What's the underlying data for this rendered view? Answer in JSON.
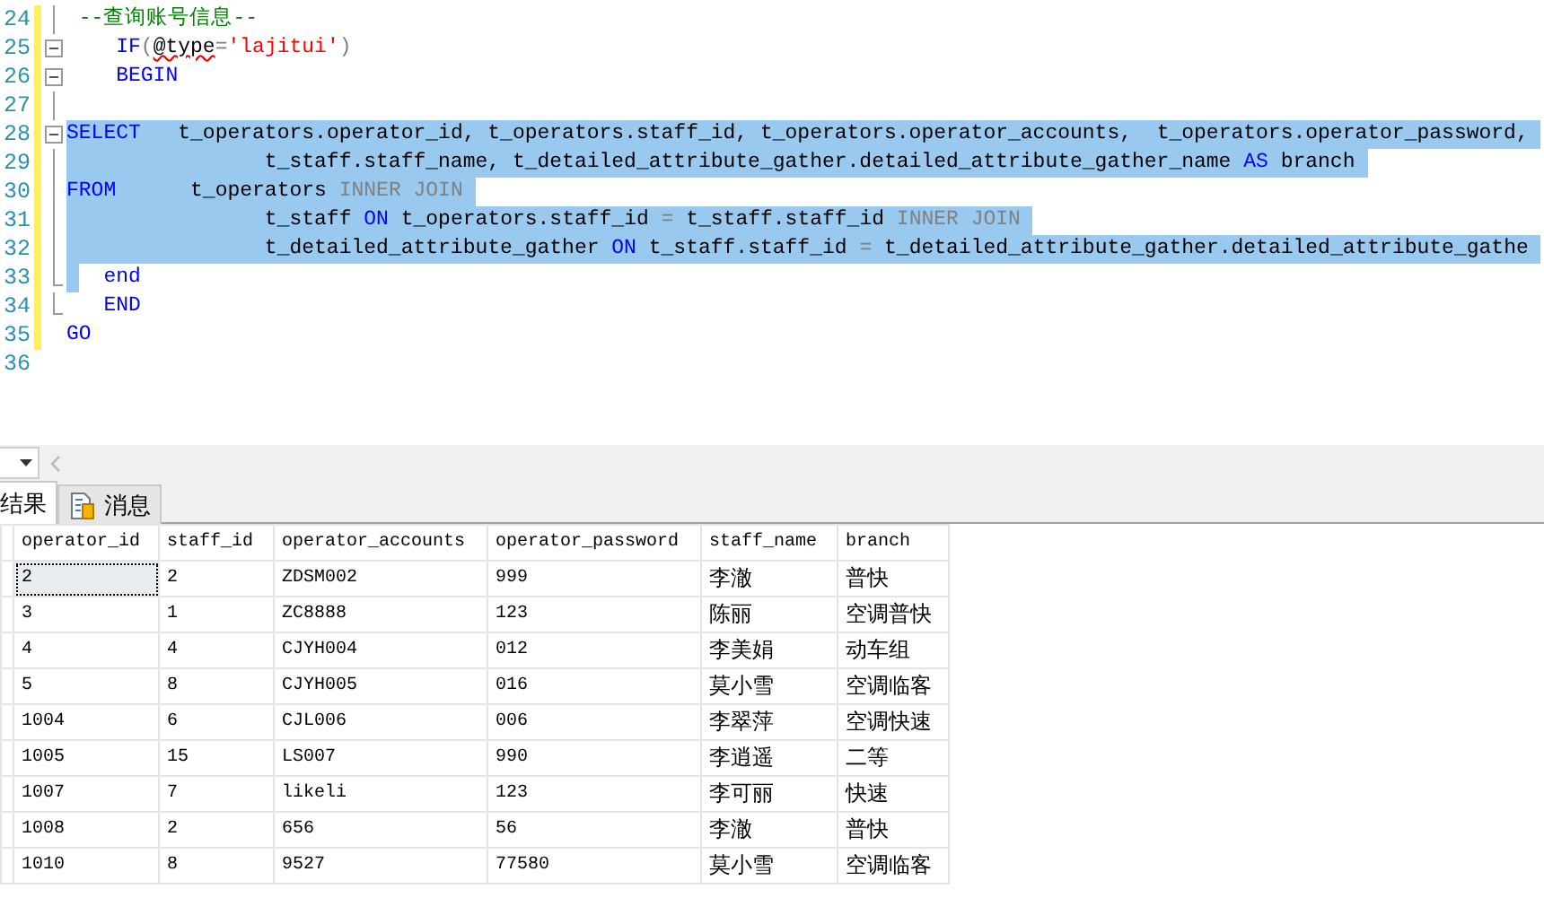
{
  "editor": {
    "lines": [
      {
        "number": "24",
        "modified": true,
        "collapsible": false,
        "outline": true,
        "outline_end": false,
        "kind": "plain",
        "tokens": [
          {
            "text": " --查询账号信息--",
            "kind": "comment"
          }
        ]
      },
      {
        "number": "25",
        "modified": true,
        "collapsible": true,
        "outline": false,
        "outline_end": false,
        "kind": "plain",
        "tokens": [
          {
            "text": "    IF",
            "kind": "keyword"
          },
          {
            "text": "(",
            "kind": "operator"
          },
          {
            "text": "@type",
            "kind": "error"
          },
          {
            "text": "=",
            "kind": "operator"
          },
          {
            "text": "'lajitui'",
            "kind": "string"
          },
          {
            "text": ")",
            "kind": "operator"
          }
        ]
      },
      {
        "number": "26",
        "modified": true,
        "collapsible": true,
        "outline": false,
        "outline_end": false,
        "kind": "plain",
        "tokens": [
          {
            "text": "    BEGIN",
            "kind": "keyword"
          }
        ]
      },
      {
        "number": "27",
        "modified": true,
        "collapsible": false,
        "outline": true,
        "outline_end": false,
        "kind": "plain"
      },
      {
        "number": "28",
        "modified": true,
        "collapsible": true,
        "outline": false,
        "outline_end": false,
        "kind": "selected",
        "tokens": [
          {
            "text": "SELECT",
            "kind": "keyword"
          },
          {
            "text": "   t_operators.operator_id, t_operators.staff_id, t_operators.operator_accounts,  t_operators.operator_password,",
            "kind": "plain"
          }
        ]
      },
      {
        "number": "29",
        "modified": true,
        "collapsible": false,
        "outline": true,
        "outline_end": false,
        "kind": "selected",
        "tokens": [
          {
            "text": "                t_staff.staff_name, t_detailed_attribute_gather.detailed_attribute_gather_name ",
            "kind": "plain"
          },
          {
            "text": "AS",
            "kind": "keyword"
          },
          {
            "text": " branch",
            "kind": "plain"
          }
        ]
      },
      {
        "number": "30",
        "modified": true,
        "collapsible": false,
        "outline": true,
        "outline_end": false,
        "kind": "selected",
        "tokens": [
          {
            "text": "FROM",
            "kind": "keyword"
          },
          {
            "text": "      t_operators ",
            "kind": "plain"
          },
          {
            "text": "INNER JOIN",
            "kind": "operator"
          }
        ]
      },
      {
        "number": "31",
        "modified": true,
        "collapsible": false,
        "outline": true,
        "outline_end": false,
        "kind": "selected",
        "tokens": [
          {
            "text": "                t_staff ",
            "kind": "plain"
          },
          {
            "text": "ON",
            "kind": "keyword"
          },
          {
            "text": " t_operators.staff_id ",
            "kind": "plain"
          },
          {
            "text": "=",
            "kind": "operator"
          },
          {
            "text": " t_staff.staff_id ",
            "kind": "plain"
          },
          {
            "text": "INNER JOIN",
            "kind": "operator"
          }
        ]
      },
      {
        "number": "32",
        "modified": true,
        "collapsible": false,
        "outline": true,
        "outline_end": false,
        "kind": "selected",
        "tokens": [
          {
            "text": "                t_detailed_attribute_gather ",
            "kind": "plain"
          },
          {
            "text": "ON",
            "kind": "keyword"
          },
          {
            "text": " t_staff.staff_id ",
            "kind": "plain"
          },
          {
            "text": "=",
            "kind": "operator"
          },
          {
            "text": " t_detailed_attribute_gather.detailed_attribute_gathe",
            "kind": "plain"
          }
        ]
      },
      {
        "number": "33",
        "modified": true,
        "collapsible": false,
        "outline": false,
        "outline_end": true,
        "kind": "caret",
        "tokens": [
          {
            "text": "   end",
            "kind": "keyword"
          }
        ]
      },
      {
        "number": "34",
        "modified": true,
        "collapsible": false,
        "outline": false,
        "outline_end": true,
        "kind": "plain",
        "tokens": [
          {
            "text": "   END",
            "kind": "keyword"
          }
        ]
      },
      {
        "number": "35",
        "modified": true,
        "collapsible": false,
        "outline": false,
        "outline_end": false,
        "kind": "plain",
        "tokens": [
          {
            "text": "GO",
            "kind": "keyword"
          }
        ]
      },
      {
        "number": "36",
        "modified": false,
        "collapsible": false,
        "outline": false,
        "outline_end": false,
        "kind": "plain"
      }
    ]
  },
  "results": {
    "tabs": [
      {
        "label": "结果",
        "selected": true
      },
      {
        "label": "消息",
        "selected": false
      }
    ],
    "columns": [
      "operator_id",
      "staff_id",
      "operator_accounts",
      "operator_password",
      "staff_name",
      "branch"
    ],
    "rows": [
      {
        "selected": true,
        "cells": [
          "2",
          "2",
          "ZDSM002",
          "999",
          "李澈",
          "普快"
        ]
      },
      {
        "selected": false,
        "cells": [
          "3",
          "1",
          "ZC8888",
          "123",
          "陈丽",
          "空调普快"
        ]
      },
      {
        "selected": false,
        "cells": [
          "4",
          "4",
          "CJYH004",
          "012",
          "李美娟",
          "动车组"
        ]
      },
      {
        "selected": false,
        "cells": [
          "5",
          "8",
          "CJYH005",
          "016",
          "莫小雪",
          "空调临客"
        ]
      },
      {
        "selected": false,
        "cells": [
          "1004",
          "6",
          "CJL006",
          "006",
          "李翠萍",
          "空调快速"
        ]
      },
      {
        "selected": false,
        "cells": [
          "1005",
          "15",
          "LS007",
          "990",
          "李逍遥",
          "二等"
        ]
      },
      {
        "selected": false,
        "cells": [
          "1007",
          "7",
          "likeli",
          "123",
          "李可丽",
          "快速"
        ]
      },
      {
        "selected": false,
        "cells": [
          "1008",
          "2",
          "656",
          "56",
          "李澈",
          "普快"
        ]
      },
      {
        "selected": false,
        "cells": [
          "1010",
          "8",
          "9527",
          "77580",
          "莫小雪",
          "空调临客"
        ]
      }
    ]
  }
}
